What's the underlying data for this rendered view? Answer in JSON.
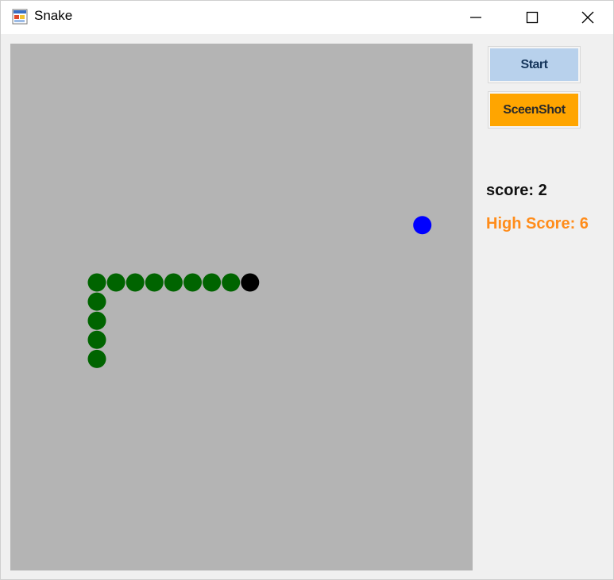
{
  "window": {
    "title": "Snake",
    "icon": "snake-app-icon",
    "controls": {
      "minimize_icon": "minimize-icon",
      "maximize_icon": "maximize-icon",
      "close_icon": "close-icon"
    }
  },
  "buttons": {
    "start_label": "Start",
    "screenshot_label": "SceenShot"
  },
  "scoreboard": {
    "score_text": "score: 2",
    "high_score_text": "High Score: 6"
  },
  "colors": {
    "board": "#b4b4b4",
    "snake_body": "#006400",
    "snake_head": "#000000",
    "food": "#0000ff",
    "start_button": "#b8d1ec",
    "screenshot_button": "#ffa500",
    "high_score_text": "#ff8c1a"
  },
  "game": {
    "grid_cell": "one segment",
    "snake": {
      "head": [
        8,
        0
      ],
      "body": [
        [
          7,
          0
        ],
        [
          6,
          0
        ],
        [
          5,
          0
        ],
        [
          4,
          0
        ],
        [
          3,
          0
        ],
        [
          2,
          0
        ],
        [
          1,
          0
        ],
        [
          0,
          0
        ],
        [
          0,
          1
        ],
        [
          0,
          2
        ],
        [
          0,
          3
        ],
        [
          0,
          4
        ]
      ]
    },
    "food": [
      17,
      -3
    ]
  }
}
